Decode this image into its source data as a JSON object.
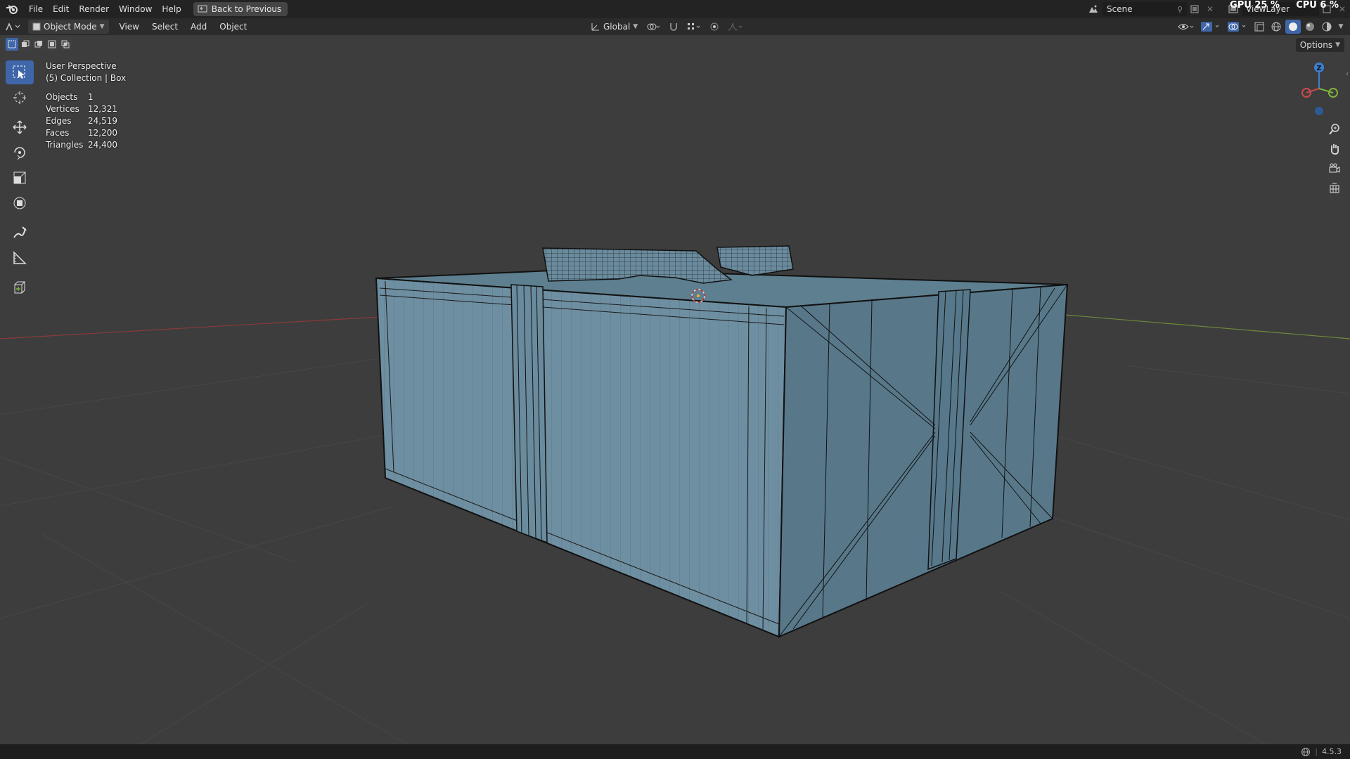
{
  "menubar": {
    "items": [
      "File",
      "Edit",
      "Render",
      "Window",
      "Help"
    ],
    "back_label": "Back to Previous"
  },
  "top_right": {
    "scene_label": "Scene",
    "viewlayer_label": "ViewLayer",
    "gpu_label": "GPU",
    "gpu_value": "25 %",
    "cpu_label": "CPU",
    "cpu_value": "6 %"
  },
  "viewport_header": {
    "mode": "Object Mode",
    "menus": [
      "View",
      "Select",
      "Add",
      "Object"
    ],
    "orientation": "Global"
  },
  "options_label": "Options",
  "overlay": {
    "perspective": "User Perspective",
    "collection": "(5) Collection | Box",
    "stats": [
      {
        "label": "Objects",
        "value": "1"
      },
      {
        "label": "Vertices",
        "value": "12,321"
      },
      {
        "label": "Edges",
        "value": "24,519"
      },
      {
        "label": "Faces",
        "value": "12,200"
      },
      {
        "label": "Triangles",
        "value": "24,400"
      }
    ]
  },
  "gizmo": {
    "z_label": "Z"
  },
  "statusbar": {
    "version": "4.5.3"
  },
  "colors": {
    "selection_active": "#3f66a8",
    "mesh_face": "#6e8ea0",
    "mesh_wire": "#141414",
    "x_axis": "#a33a3a",
    "y_axis": "#7f9a3a",
    "gizmo_x": "#d0484d",
    "gizmo_y": "#7fb33c",
    "gizmo_z": "#3d7fcf"
  },
  "icons": {
    "tools": [
      "select-box-icon",
      "cursor-icon",
      "move-icon",
      "rotate-icon",
      "scale-icon",
      "transform-icon",
      "annotate-icon",
      "measure-icon",
      "add-cube-icon"
    ],
    "nav": [
      "zoom-icon",
      "pan-hand-icon",
      "camera-icon",
      "grid-ortho-icon"
    ]
  }
}
